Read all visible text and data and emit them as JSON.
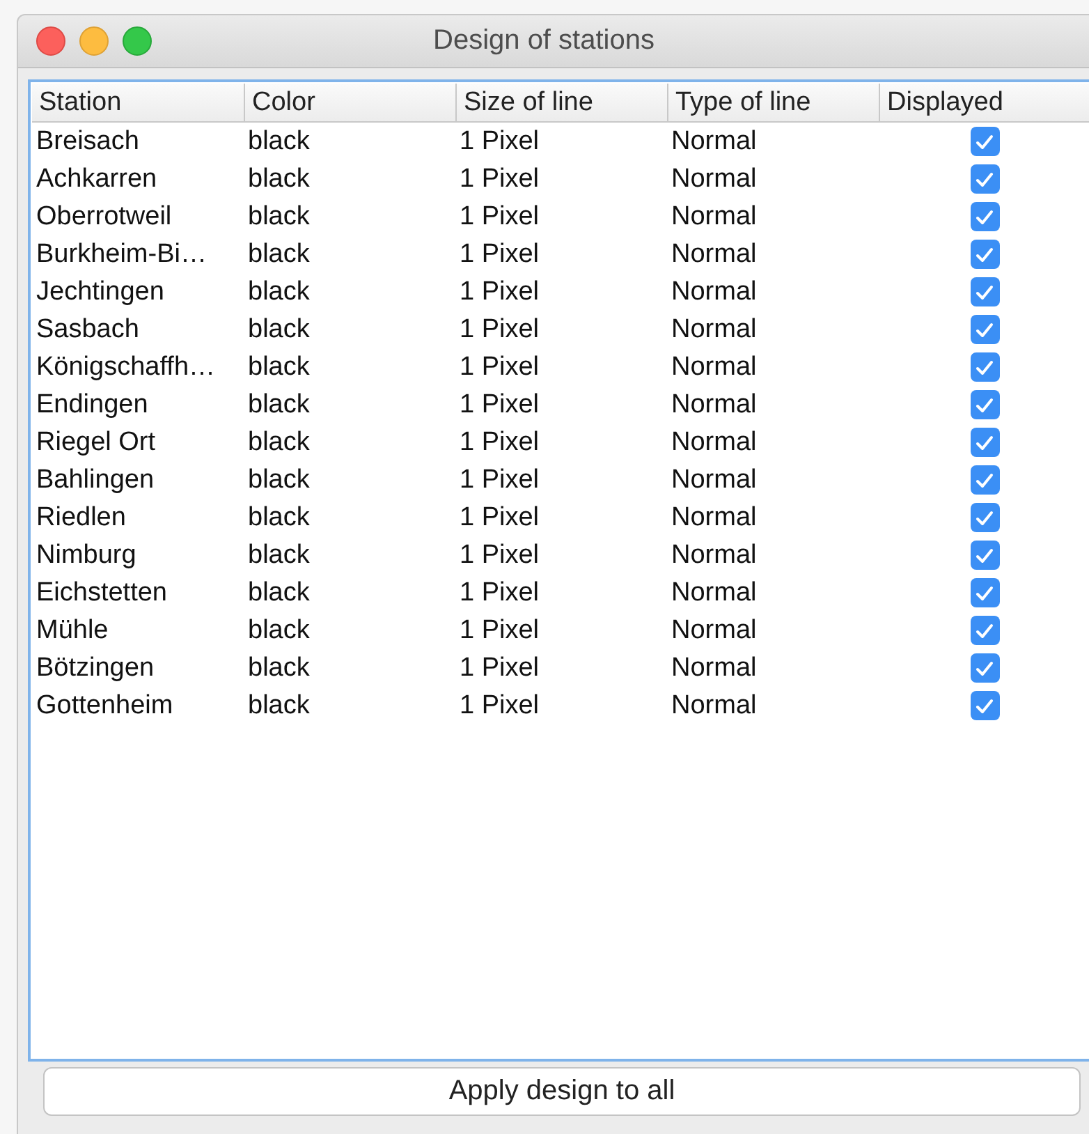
{
  "window": {
    "title": "Design of stations"
  },
  "table": {
    "columns": [
      "Station",
      "Color",
      "Size of line",
      "Type of line",
      "Displayed"
    ],
    "rows": [
      {
        "station": "Breisach",
        "color_name": "black",
        "size": "1 Pixel",
        "type": "Normal",
        "displayed": true
      },
      {
        "station": "Achkarren",
        "color_name": "black",
        "size": "1 Pixel",
        "type": "Normal",
        "displayed": true
      },
      {
        "station": "Oberrotweil",
        "color_name": "black",
        "size": "1 Pixel",
        "type": "Normal",
        "displayed": true
      },
      {
        "station": "Burkheim-Bi…",
        "color_name": "black",
        "size": "1 Pixel",
        "type": "Normal",
        "displayed": true
      },
      {
        "station": "Jechtingen",
        "color_name": "black",
        "size": "1 Pixel",
        "type": "Normal",
        "displayed": true
      },
      {
        "station": "Sasbach",
        "color_name": "black",
        "size": "1 Pixel",
        "type": "Normal",
        "displayed": true
      },
      {
        "station": "Königschaffh…",
        "color_name": "black",
        "size": "1 Pixel",
        "type": "Normal",
        "displayed": true
      },
      {
        "station": "Endingen",
        "color_name": "black",
        "size": "1 Pixel",
        "type": "Normal",
        "displayed": true
      },
      {
        "station": "Riegel Ort",
        "color_name": "black",
        "size": "1 Pixel",
        "type": "Normal",
        "displayed": true
      },
      {
        "station": "Bahlingen",
        "color_name": "black",
        "size": "1 Pixel",
        "type": "Normal",
        "displayed": true
      },
      {
        "station": "Riedlen",
        "color_name": "black",
        "size": "1 Pixel",
        "type": "Normal",
        "displayed": true
      },
      {
        "station": "Nimburg",
        "color_name": "black",
        "size": "1 Pixel",
        "type": "Normal",
        "displayed": true
      },
      {
        "station": "Eichstetten",
        "color_name": "black",
        "size": "1 Pixel",
        "type": "Normal",
        "displayed": true
      },
      {
        "station": "Mühle",
        "color_name": "black",
        "size": "1 Pixel",
        "type": "Normal",
        "displayed": true
      },
      {
        "station": "Bötzingen",
        "color_name": "black",
        "size": "1 Pixel",
        "type": "Normal",
        "displayed": true
      },
      {
        "station": "Gottenheim",
        "color_name": "black",
        "size": "1 Pixel",
        "type": "Normal",
        "displayed": true
      }
    ]
  },
  "button": "Apply design to all"
}
